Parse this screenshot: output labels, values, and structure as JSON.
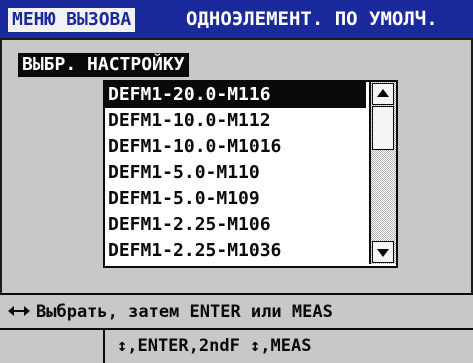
{
  "titlebar": {
    "menu_tab": "МЕНЮ ВЫЗОВА",
    "title": "ОДНОЭЛЕМЕНТ. ПО УМОЛЧ."
  },
  "panel": {
    "section_label": "ВЫБР. НАСТРОЙКУ",
    "items": [
      {
        "label": "DEFM1-20.0-M116",
        "selected": true
      },
      {
        "label": "DEFM1-10.0-M112",
        "selected": false
      },
      {
        "label": "DEFM1-10.0-M1016",
        "selected": false
      },
      {
        "label": "DEFM1-5.0-M110",
        "selected": false
      },
      {
        "label": "DEFM1-5.0-M109",
        "selected": false
      },
      {
        "label": "DEFM1-2.25-M106",
        "selected": false
      },
      {
        "label": "DEFM1-2.25-M1036",
        "selected": false
      }
    ]
  },
  "hint": {
    "icon": "left-right-arrow-icon",
    "text": "Выбрать, затем ENTER или MEAS"
  },
  "keys": {
    "text": "↕,ENTER,2ndF ↕,MEAS"
  },
  "colors": {
    "title_bg": "#1a2a9c",
    "panel_bg": "#c8c8c8",
    "selection": "#0a0a0a"
  }
}
